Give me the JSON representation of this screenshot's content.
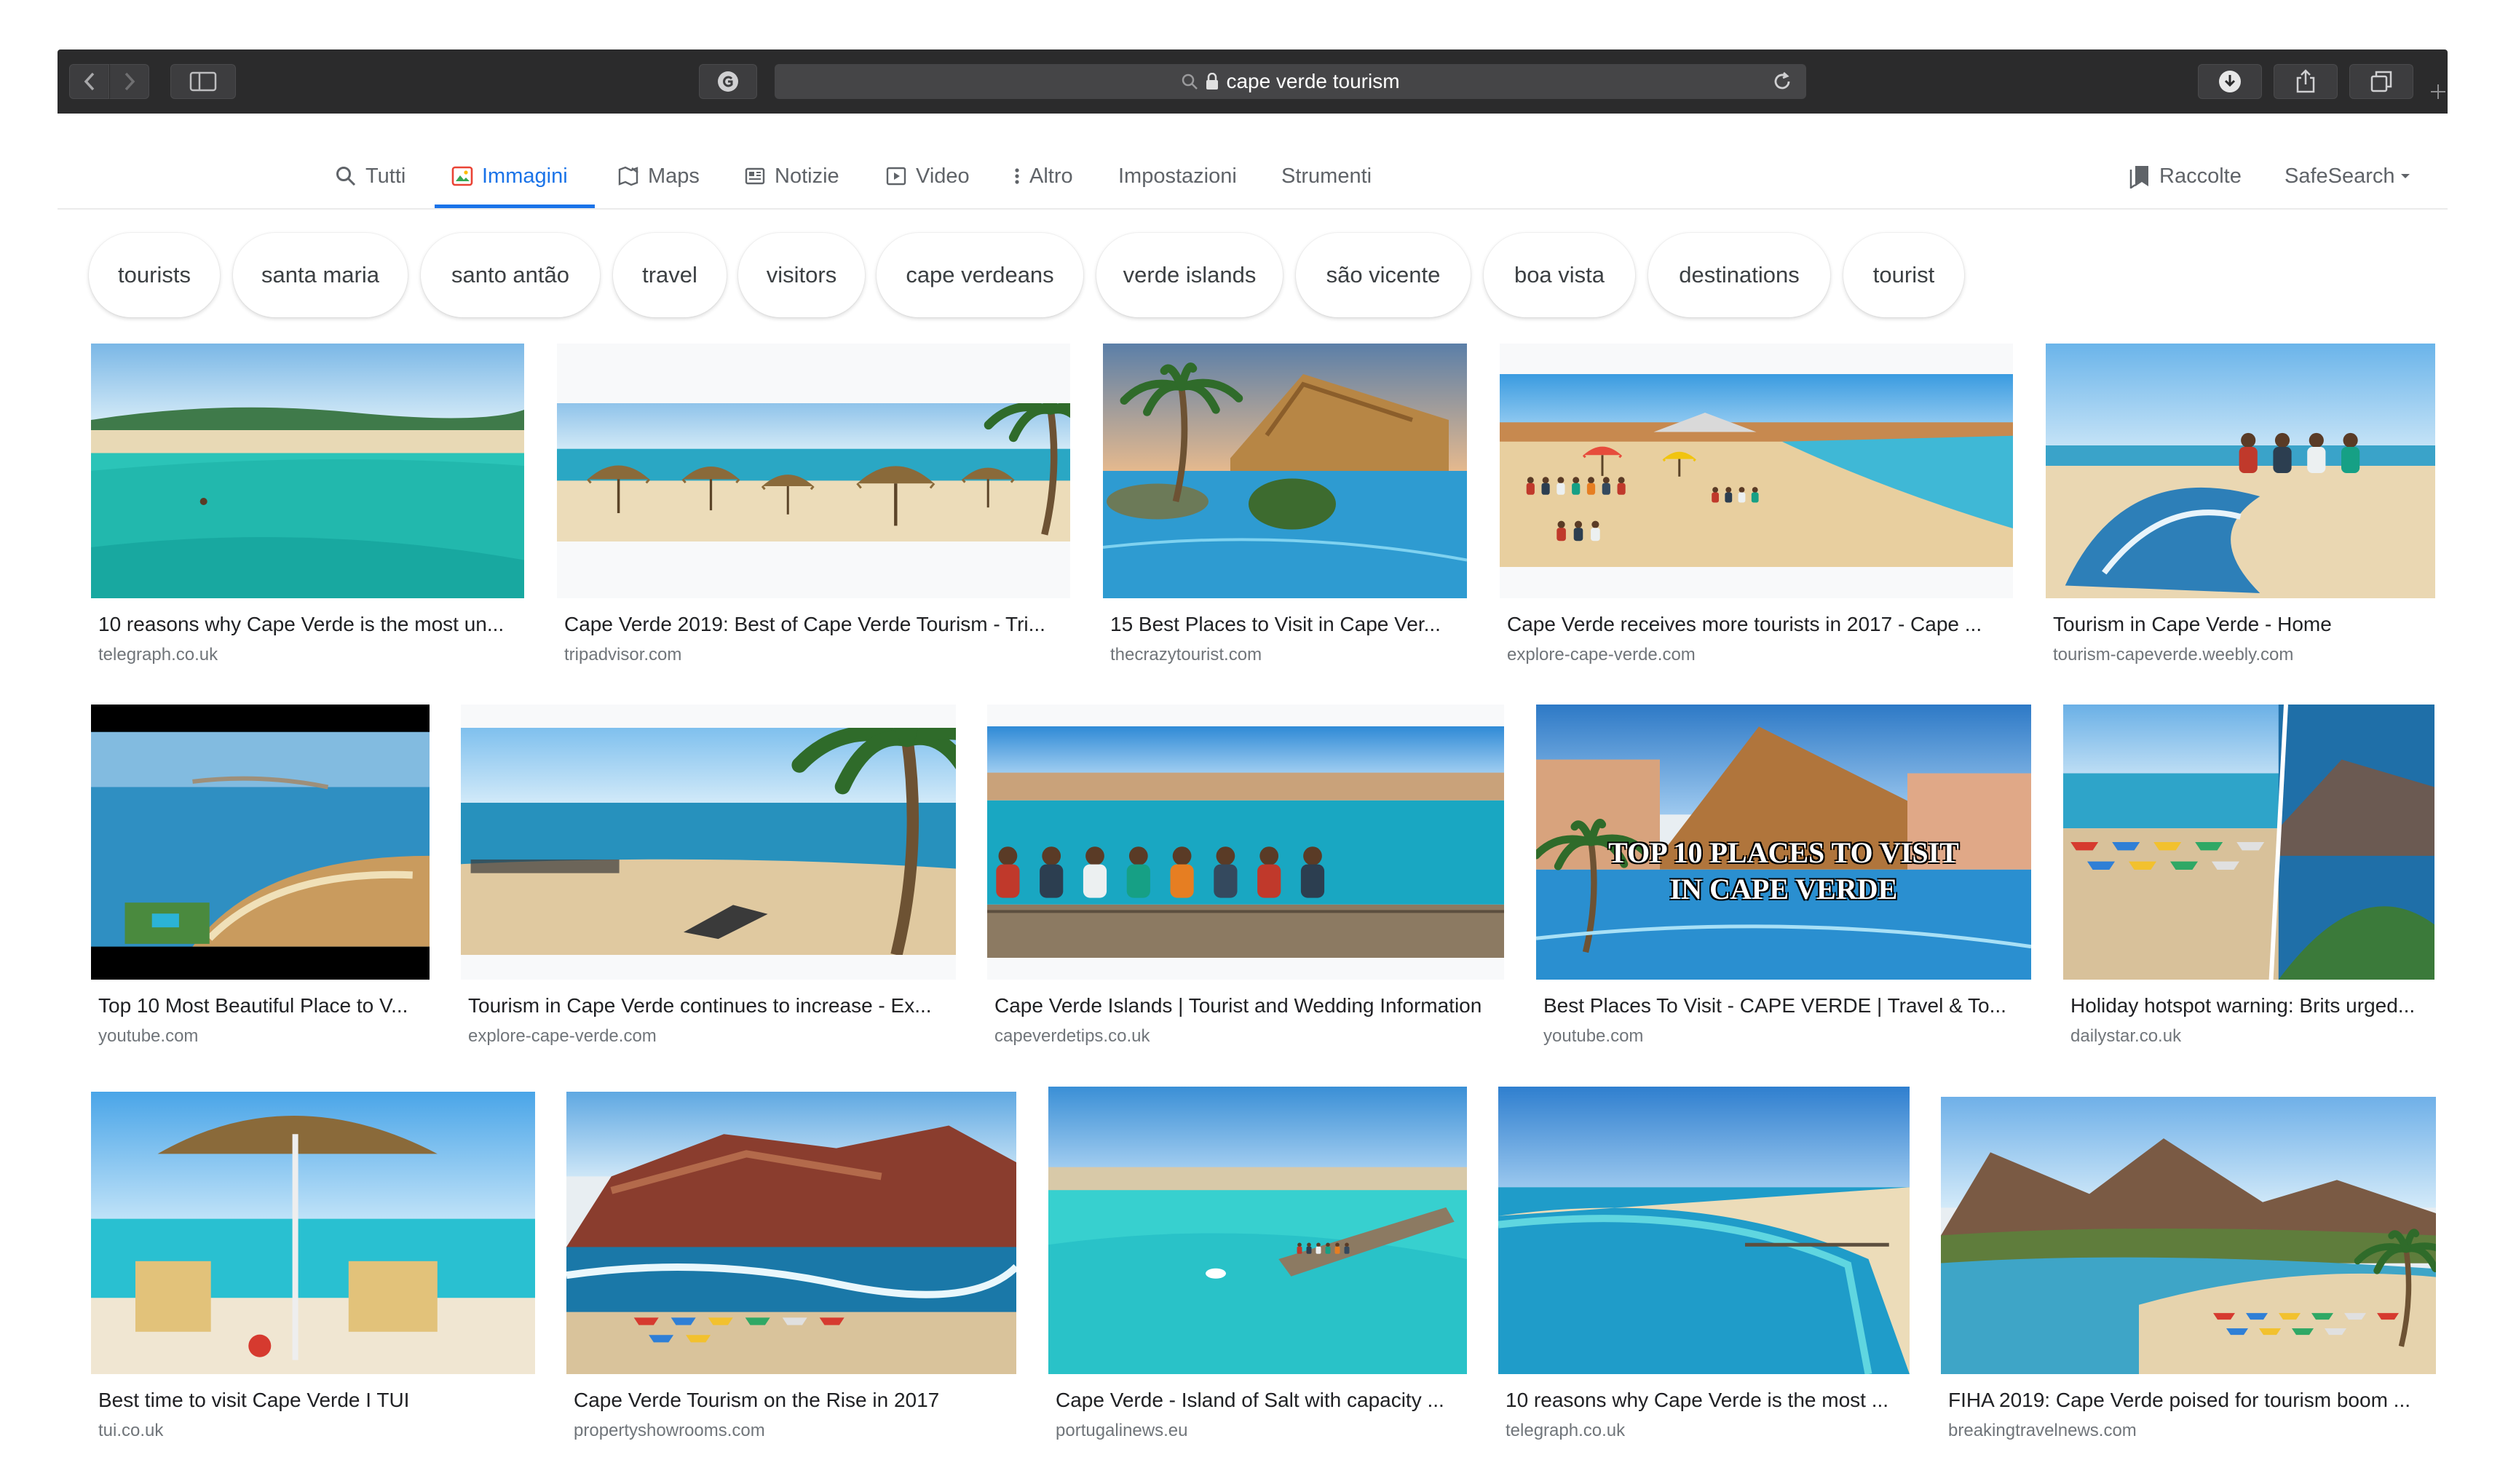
{
  "browser": {
    "url_display": "cape verde tourism"
  },
  "tabs": [
    {
      "label": "Tutti",
      "icon": "search-icon"
    },
    {
      "label": "Immagini",
      "icon": "image-icon",
      "active": true
    },
    {
      "label": "Maps",
      "icon": "map-icon"
    },
    {
      "label": "Notizie",
      "icon": "news-icon"
    },
    {
      "label": "Video",
      "icon": "video-icon"
    },
    {
      "label": "Altro",
      "icon": "more-vert-icon"
    },
    {
      "label": "Impostazioni"
    },
    {
      "label": "Strumenti"
    }
  ],
  "right_tools": {
    "collections": "Raccolte",
    "safesearch": "SafeSearch"
  },
  "chips": [
    "tourists",
    "santa maria",
    "santo antão",
    "travel",
    "visitors",
    "cape verdeans",
    "verde islands",
    "são vicente",
    "boa vista",
    "destinations",
    "tourist"
  ],
  "results": [
    {
      "title": "10 reasons why Cape Verde is the most un...",
      "source": "telegraph.co.uk",
      "scene": "beach-aerial"
    },
    {
      "title": "Cape Verde 2019: Best of Cape Verde Tourism - Tri...",
      "source": "tripadvisor.com",
      "scene": "umbrellas-beach"
    },
    {
      "title": "15 Best Places to Visit in Cape Ver...",
      "source": "thecrazytourist.com",
      "scene": "resort-pool"
    },
    {
      "title": "Cape Verde receives more tourists in 2017 - Cape ...",
      "source": "explore-cape-verde.com",
      "scene": "busy-beach"
    },
    {
      "title": "Tourism in Cape Verde - Home",
      "source": "tourism-capeverde.weebly.com",
      "scene": "kitesurf-beach"
    },
    {
      "title": "Top 10 Most Beautiful Place to V...",
      "source": "youtube.com",
      "scene": "coast-aerial"
    },
    {
      "title": "Tourism in Cape Verde continues to increase - Ex...",
      "source": "explore-cape-verde.com",
      "scene": "palm-beach"
    },
    {
      "title": "Cape Verde Islands | Tourist and Wedding Information",
      "source": "capeverdetips.co.uk",
      "scene": "pier-people"
    },
    {
      "title": "Best Places To Visit - CAPE VERDE | Travel & To...",
      "source": "youtube.com",
      "scene": "resort-video",
      "overlay_lines": [
        "TOP 10 PLACES TO VISIT",
        "IN CAPE VERDE"
      ]
    },
    {
      "title": "Holiday hotspot warning: Brits urged...",
      "source": "dailystar.co.uk",
      "scene": "boats-collage"
    },
    {
      "title": "Best time to visit Cape Verde I TUI",
      "source": "tui.co.uk",
      "scene": "parasol-chairs"
    },
    {
      "title": "Cape Verde Tourism on the Rise in 2017",
      "source": "propertyshowrooms.com",
      "scene": "red-cliffs"
    },
    {
      "title": "Cape Verde - Island of Salt with capacity ...",
      "source": "portugalinews.eu",
      "scene": "turquoise-pier"
    },
    {
      "title": "10 reasons why Cape Verde is the most ...",
      "source": "telegraph.co.uk",
      "scene": "bay-curve"
    },
    {
      "title": "FIHA 2019: Cape Verde poised for tourism boom ...",
      "source": "breakingtravelnews.com",
      "scene": "mountain-bay"
    }
  ]
}
